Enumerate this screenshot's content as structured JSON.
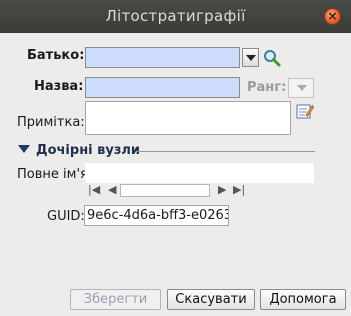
{
  "window": {
    "title": "Літостратиграфії",
    "close_glyph": "⊗"
  },
  "form": {
    "parent_label": "Батько:",
    "parent_value": "",
    "name_label": "Назва:",
    "name_value": "",
    "rank_label": "Ранг:",
    "note_label": "Примітка:",
    "note_value": ""
  },
  "children_section": {
    "header": "Дочірні вузли",
    "fullname_label": "Повне ім'я:",
    "fullname_value": ""
  },
  "guid": {
    "label": "GUID:",
    "value": "9e6c-4d6a-bff3-e0263"
  },
  "buttons": {
    "save": "Зберегти",
    "cancel": "Скасувати",
    "help": "Допомога"
  },
  "icons": {
    "search": "search-icon",
    "edit": "edit-icon"
  },
  "colors": {
    "required_field_bg": "#ccdcfa",
    "titlebar_bg": "#3e3e3b",
    "close_btn": "#e0602f"
  }
}
